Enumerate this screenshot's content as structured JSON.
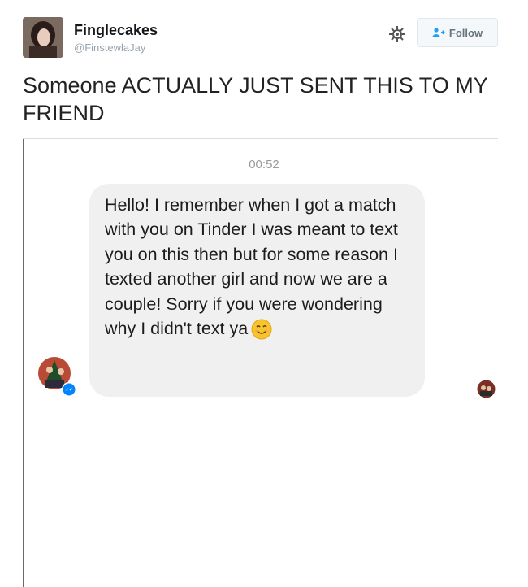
{
  "tweet": {
    "display_name": "Finglecakes",
    "handle": "@FinstewlaJay",
    "follow_label": "Follow",
    "text": "Someone ACTUALLY JUST SENT THIS TO MY FRIEND",
    "icons": {
      "settings": "gear-icon",
      "follow": "add-person-icon"
    }
  },
  "screenshot": {
    "timestamp": "00:52",
    "message": "Hello! I remember when I got a match with you on Tinder I was meant to text you on this then but for some reason I texted another girl and now we are a couple! Sorry if you were wondering why I didn't text ya",
    "emoji": "smiling-face-emoji",
    "colors": {
      "bubble": "#f1f0f0",
      "messenger_badge": "#0084ff"
    }
  }
}
